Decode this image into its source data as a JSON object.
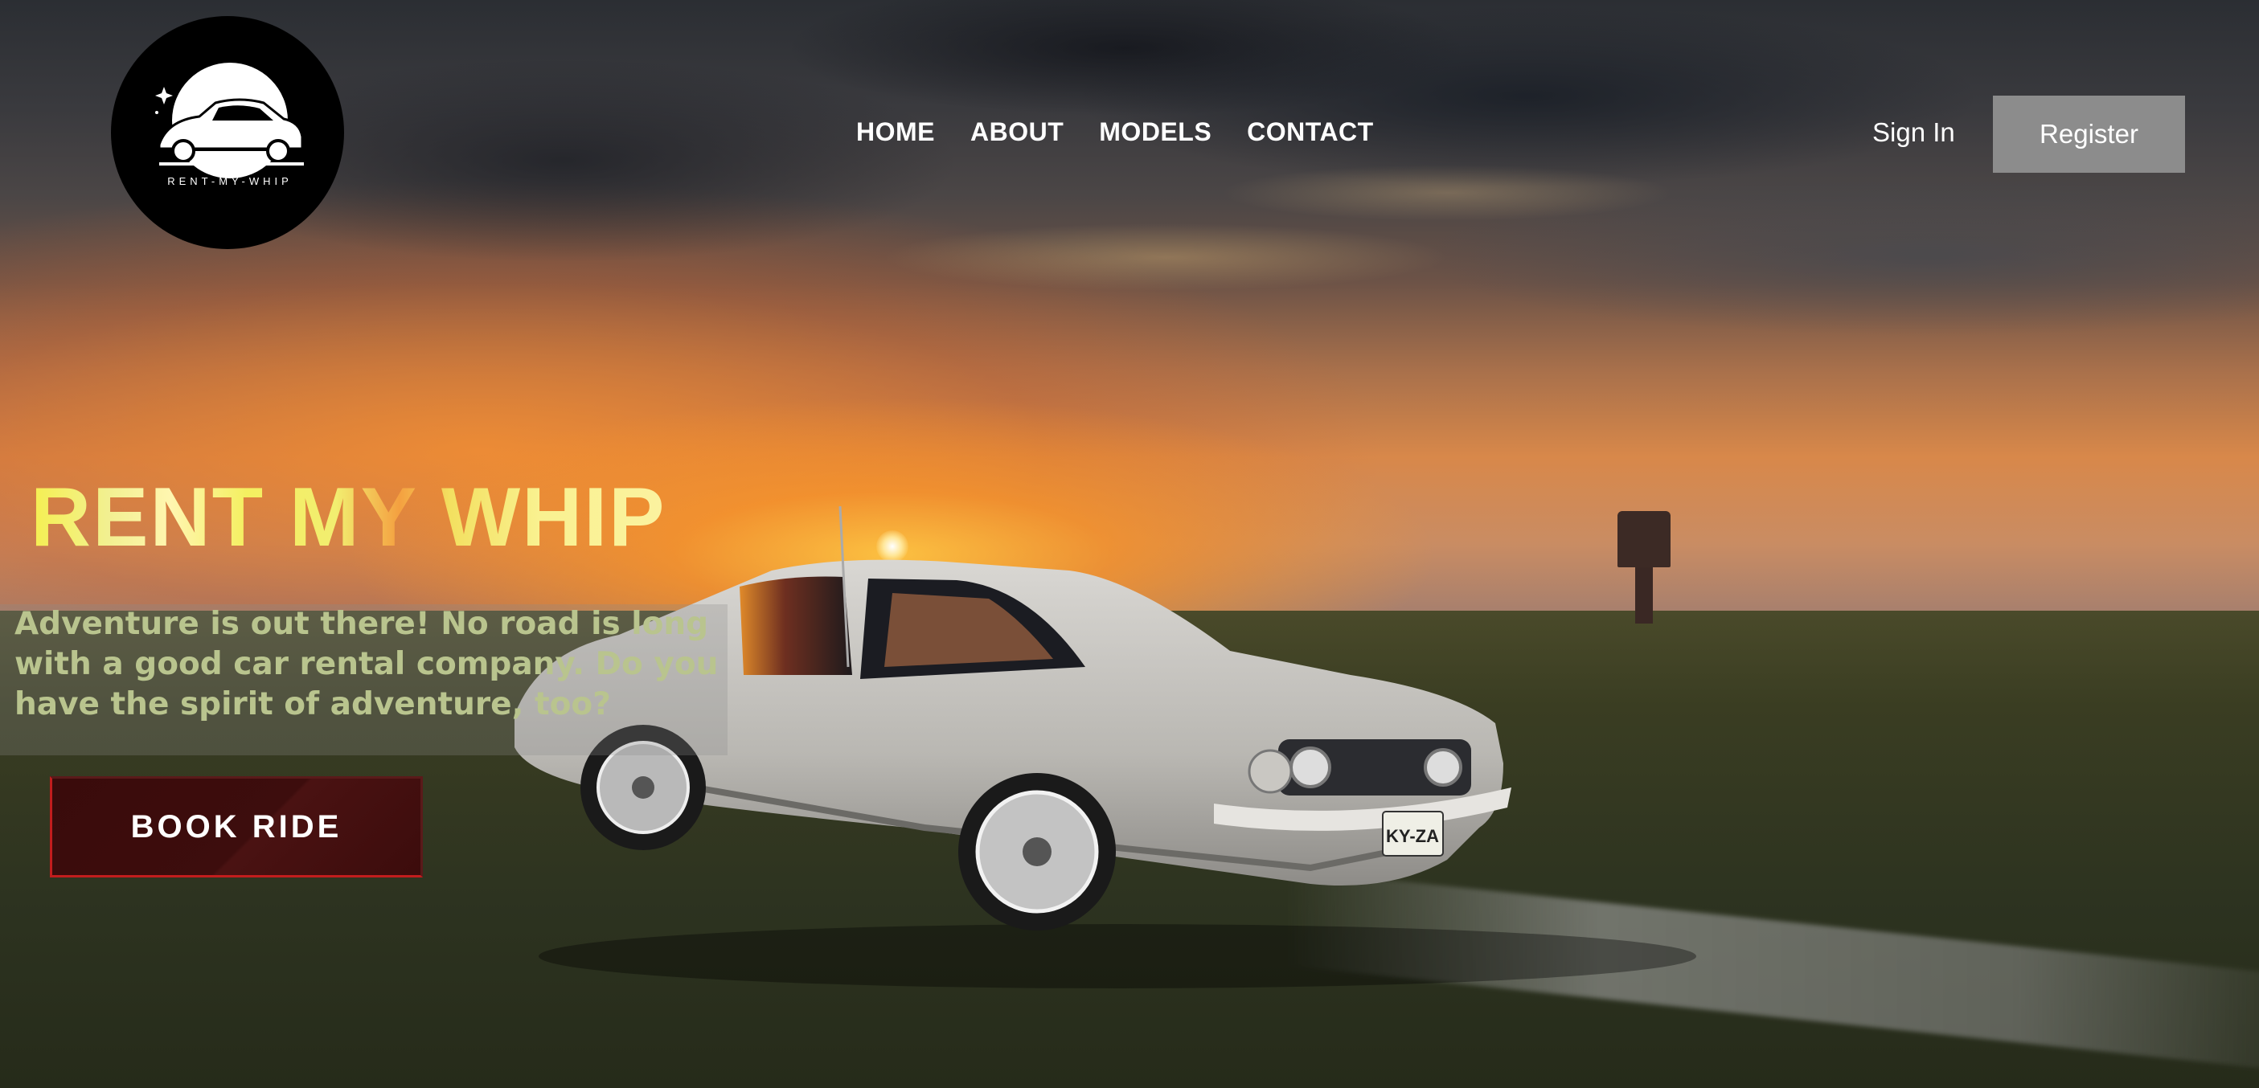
{
  "brand": {
    "logo_text": "RENT-MY-WHIP"
  },
  "nav": {
    "items": [
      {
        "label": "HOME"
      },
      {
        "label": "ABOUT"
      },
      {
        "label": "MODELS"
      },
      {
        "label": "CONTACT"
      }
    ]
  },
  "auth": {
    "signin_label": "Sign In",
    "register_label": "Register"
  },
  "hero": {
    "title": "RENT MY WHIP",
    "tagline_lines": [
      "Adventure is out there! No road is long",
      "with a good car rental company. Do you",
      "have the spirit of adventure, too?"
    ],
    "cta_label": "BOOK RIDE",
    "plate_text": "KY-ZA"
  },
  "colors": {
    "register_bg": "#8c8c8c",
    "cta_bg": "#3a0b0b",
    "cta_accent": "#c21d1d",
    "tagline_text": "#b9c48e",
    "title_yellow": "#f5ef50"
  },
  "icons": [
    "logo-car-icon",
    "sparkle-icon"
  ]
}
